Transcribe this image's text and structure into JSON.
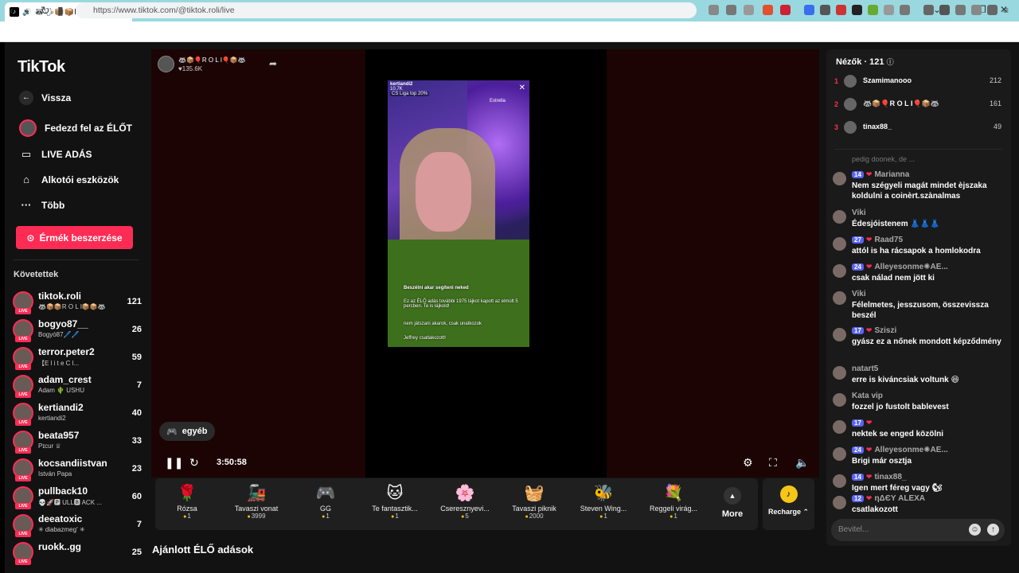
{
  "browser": {
    "tab_title": "🦝🗣📦📦R O L I📦📦🦝 (@ti",
    "url": "https://www.tiktok.com/@tiktok.roli/live"
  },
  "sidebar": {
    "logo": "TikTok",
    "menu": [
      {
        "label": "Vissza",
        "icon": "back-arrow-icon"
      },
      {
        "label": "Fedezd fel az ÉLŐT",
        "icon": "explore-avatar-icon"
      },
      {
        "label": "LIVE ADÁS",
        "icon": "camera-icon"
      },
      {
        "label": "Alkotói eszközök",
        "icon": "creator-tools-icon"
      },
      {
        "label": "Több",
        "icon": "more-dots-icon"
      }
    ],
    "coin_button": "Érmék beszerzése",
    "following_title": "Követettek",
    "following": [
      {
        "name": "tiktok.roli",
        "sub": "🦝📦📦R O L I📦📦🦝",
        "count": "121"
      },
      {
        "name": "bogyo87__",
        "sub": "Bogyó87🖊️🖊️",
        "count": "26"
      },
      {
        "name": "terror.peter2",
        "sub": "【E l i t e  C l...",
        "count": "59"
      },
      {
        "name": "adam_crest",
        "sub": "Adam 🌵 USHU",
        "count": "7"
      },
      {
        "name": "kertiandi2",
        "sub": "kertiandi2",
        "count": "40"
      },
      {
        "name": "beata957",
        "sub": "Pɪcur ♕",
        "count": "33"
      },
      {
        "name": "kocsandiistvan",
        "sub": "István Papa",
        "count": "23"
      },
      {
        "name": "pullback10",
        "sub": "💀🚀🅿 ULL🅱 ACK ...",
        "count": "60"
      },
      {
        "name": "deeatoxic",
        "sub": "✳ diabazmeg' ✳",
        "count": "7"
      },
      {
        "name": "ruokk..gg",
        "sub": "",
        "count": "25"
      }
    ]
  },
  "live": {
    "host_name": "🦝📦🎈R O L I🎈📦🦝",
    "host_likes": "♥135.6K",
    "category": "egyéb",
    "time": "3:50:58",
    "video_overlay": {
      "streamer": "kertiandi2",
      "streamer_likes": "10.7K",
      "top_tag": "CS Liga top 20%",
      "top_right": "Estrella",
      "line1": "Beszélni akar segíteni neked",
      "line2": "Ez az ÉLŐ adás további 1975 lájkot kapott az elmúlt 5 percben. Te is lájkold!",
      "line3": "nem játszani akarok, csak unatkozok",
      "line4": "Jeffrey csatlakozott!"
    }
  },
  "gifts": [
    {
      "name": "Rózsa",
      "price": "1",
      "icon": "🌹"
    },
    {
      "name": "Tavaszi vonat",
      "price": "3999",
      "icon": "🚂"
    },
    {
      "name": "GG",
      "price": "1",
      "icon": "🎮"
    },
    {
      "name": "Te fantasztik...",
      "price": "1",
      "icon": "🐱"
    },
    {
      "name": "Cseresznyevi...",
      "price": "5",
      "icon": "🌸"
    },
    {
      "name": "Tavaszi piknik",
      "price": "2000",
      "icon": "🧺"
    },
    {
      "name": "Steven Wing...",
      "price": "1",
      "icon": "🐝"
    },
    {
      "name": "Reggeli virág...",
      "price": "1",
      "icon": "💐"
    }
  ],
  "more_label": "More",
  "recharge_label": "Recharge",
  "recommended_title": "Ajánlott ÉLŐ adások",
  "chat": {
    "viewers_title": "Nézők · 121",
    "top_viewers": [
      {
        "rank": "1",
        "name": "Szamimanooo",
        "count": "212"
      },
      {
        "rank": "2",
        "name": "🦝📦🎈R O L I🎈📦🦝",
        "count": "161"
      },
      {
        "rank": "3",
        "name": "tinax88_",
        "count": "49"
      }
    ],
    "partial_message": "pedig doonek, de ...",
    "messages": [
      {
        "badge": "14",
        "user": "Marianna",
        "text": "Nem szégyeli magát mindet èjszaka koldulni a coinèrt.szànalmas"
      },
      {
        "badge": "",
        "user": "Viki",
        "text": "Édesjóistenem 👗👗👗"
      },
      {
        "badge": "27",
        "user": "Raad75",
        "text": "attól is ha rácsapok a homlokodra"
      },
      {
        "badge": "24",
        "user": "Alleyesonme✺AE...",
        "text": "csak nálad nem jött ki"
      },
      {
        "badge": "",
        "user": "Viki",
        "text": "Félelmetes, jesszusom, összevissza beszél"
      },
      {
        "badge": "17",
        "user": "Sziszi",
        "text": "gyász ez a nőnek mondott képződmény"
      },
      {
        "badge": "",
        "user": "natart5",
        "text": "erre is kiváncsiak voltunk 😆"
      },
      {
        "badge": "",
        "user": "Kata vip",
        "text": "fozzel jo fustolt bablevest"
      },
      {
        "badge": "17",
        "user": "",
        "text": "nektek se enged közölni"
      },
      {
        "badge": "24",
        "user": "Alleyesonme✺AE...",
        "text": "Brigi már osztja"
      },
      {
        "badge": "14",
        "user": "tinax88_",
        "text": "Igen mert féreg vagy 🐿"
      },
      {
        "badge": "12",
        "user": "ηΔЄY ΑLEXΑ",
        "text": "csatlakozott"
      }
    ],
    "input_placeholder": "Bevitel..."
  }
}
